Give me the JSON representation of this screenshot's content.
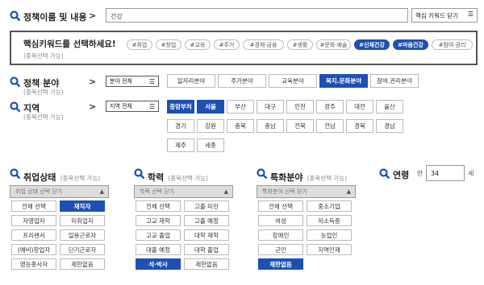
{
  "search": {
    "label": "정책이름 및 내용",
    "value": "건강",
    "toggle_label": "핵심 키워드 닫기"
  },
  "keywords": {
    "title": "핵심키워드를 선택하세요!",
    "subtitle": "(중복선택 가능)",
    "chips": [
      "#취업",
      "#창업",
      "#교육",
      "#주거",
      "#경제·금융",
      "#생활",
      "#문화·예술",
      "#신체건강",
      "#마음건강",
      "#참여·권리"
    ],
    "selected": [
      7,
      8
    ]
  },
  "policy_field": {
    "label": "정책 분야",
    "subtitle": "(중복선택 가능)",
    "dropdown": "분야 전체",
    "options": [
      "일자리분야",
      "주거분야",
      "교육분야",
      "복지.문화분야",
      "참여.권리분야"
    ],
    "selected": [
      3
    ]
  },
  "region": {
    "label": "지역",
    "subtitle": "(중복선택 가능)",
    "dropdown": "지역 전체",
    "options": [
      "중앙부처",
      "서울",
      "부산",
      "대구",
      "인천",
      "광주",
      "대전",
      "울산",
      "경기",
      "강원",
      "충북",
      "충남",
      "전북",
      "전남",
      "경북",
      "경남",
      "제주",
      "세종"
    ],
    "selected": [
      0,
      1
    ]
  },
  "employment": {
    "label": "취업상태",
    "subtitle": "(중복선택 가능)",
    "select_text": "취업 상태 선택 닫기",
    "options": [
      "전체 선택",
      "재직자",
      "자영업자",
      "미취업자",
      "프리랜서",
      "일용근로자",
      "(예비)창업자",
      "단기근로자",
      "영농종사자",
      "제한없음"
    ],
    "selected": [
      1
    ]
  },
  "education": {
    "label": "학력",
    "subtitle": "(중복선택 가능)",
    "select_text": "학력 선택 닫기",
    "options": [
      "전체 선택",
      "고졸 미만",
      "고교 재학",
      "고졸 예정",
      "고교 졸업",
      "대학 재학",
      "대졸 예정",
      "대학 졸업",
      "석·박사",
      "제한없음"
    ],
    "selected": [
      8
    ]
  },
  "specialty": {
    "label": "특화분야",
    "subtitle": "(중복선택 가능)",
    "select_text": "특화분야 선택 닫기",
    "options": [
      "전체 선택",
      "중소기업",
      "여성",
      "저소득층",
      "장애인",
      "농업인",
      "군인",
      "지역인재",
      "제한없음"
    ],
    "selected": [
      8
    ]
  },
  "age": {
    "label": "연령",
    "prefix": "만",
    "value": "34",
    "suffix": "세"
  }
}
